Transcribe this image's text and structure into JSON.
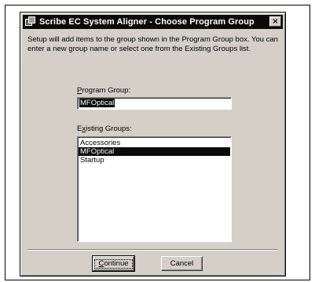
{
  "window": {
    "title": "Scribe EC System Aligner - Choose Program Group",
    "close_glyph": "×"
  },
  "instructions": "Setup will add items to the group shown in the Program Group box. You can enter a new group name or select one from the Existing Groups list.",
  "program_group": {
    "label_mnemonic": "P",
    "label_rest": "rogram Group:",
    "value": "MFOptical"
  },
  "existing_groups": {
    "label_prefix": "E",
    "label_mnemonic": "x",
    "label_rest": "isting Groups:",
    "items": [
      "Accessories",
      "MFOptical",
      "Startup"
    ],
    "selected_index": 1
  },
  "buttons": {
    "continue_mnemonic": "C",
    "continue_rest": "ontinue",
    "cancel": "Cancel"
  },
  "icons": {
    "app": "program-group-icon",
    "close": "close-icon"
  }
}
